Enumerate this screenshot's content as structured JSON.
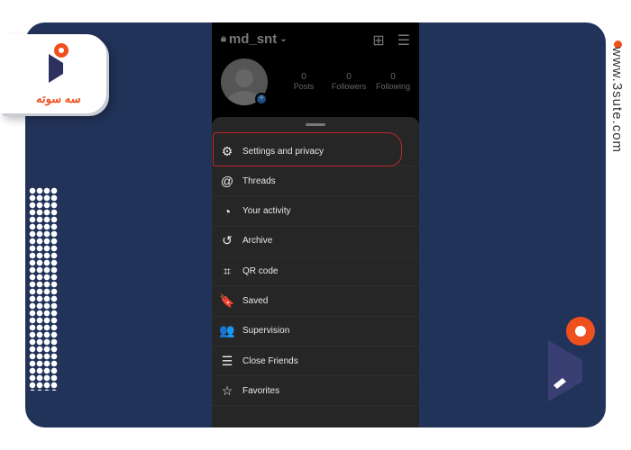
{
  "brand": {
    "site": "www.3sute.com",
    "logo_text": "سه سوته",
    "accent": "#f0501e",
    "navy": "#22335a"
  },
  "profile": {
    "username": "md_snt",
    "stats": [
      {
        "value": "0",
        "label": "Posts"
      },
      {
        "value": "0",
        "label": "Followers"
      },
      {
        "value": "0",
        "label": "Following"
      }
    ]
  },
  "menu": {
    "items": [
      {
        "label": "Settings and privacy",
        "icon": "gear-icon",
        "glyph": "⚙"
      },
      {
        "label": "Threads",
        "icon": "threads-icon",
        "glyph": "@"
      },
      {
        "label": "Your activity",
        "icon": "activity-icon",
        "glyph": "◔"
      },
      {
        "label": "Archive",
        "icon": "archive-icon",
        "glyph": "↺"
      },
      {
        "label": "QR code",
        "icon": "qr-code-icon",
        "glyph": "⌗"
      },
      {
        "label": "Saved",
        "icon": "bookmark-icon",
        "glyph": "🔖"
      },
      {
        "label": "Supervision",
        "icon": "supervision-icon",
        "glyph": "👥"
      },
      {
        "label": "Close Friends",
        "icon": "list-icon",
        "glyph": "☰"
      },
      {
        "label": "Favorites",
        "icon": "star-icon",
        "glyph": "☆"
      }
    ],
    "highlighted": "Settings and privacy"
  }
}
